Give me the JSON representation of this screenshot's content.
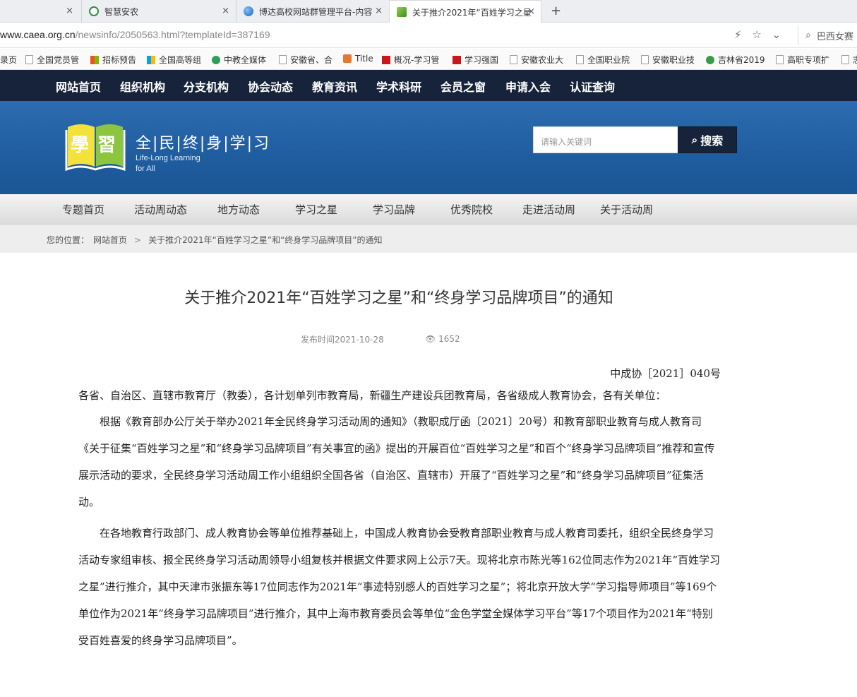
{
  "browser": {
    "tabs": [
      {
        "label": "",
        "close": "×"
      },
      {
        "label": "智慧安农",
        "close": "×"
      },
      {
        "label": "博达高校网站群管理平台-内容",
        "close": "×"
      },
      {
        "label": "关于推介2021年“百姓学习之星",
        "close": "×"
      }
    ],
    "new_tab": "+",
    "url_host": "www.caea.org.cn",
    "url_path": "/newsinfo/2050563.html?templateId=387169",
    "search_text": "巴西女赛",
    "bookmarks": [
      "录页",
      "全国党员管",
      "招标预告",
      "全国高等组",
      "中教全媒体",
      "安徽省、合",
      "Title",
      "概况-学习管",
      "学习强国",
      "安徽农业大",
      "全国职业院",
      "安徽职业技",
      "吉林省2019",
      "高职专项扩",
      "志"
    ]
  },
  "topnav": [
    "网站首页",
    "组织机构",
    "分支机构",
    "协会动态",
    "教育资讯",
    "学术科研",
    "会员之窗",
    "申请入会",
    "认证查询"
  ],
  "banner": {
    "logo_cn": "全|民|终|身|学|习",
    "logo_en_1": "Life-Long Learning",
    "logo_en_2": "for All",
    "search_placeholder": "请输入关键词",
    "search_button": "搜索"
  },
  "subnav": [
    "专题首页",
    "活动周动态",
    "地方动态",
    "学习之星",
    "学习品牌",
    "优秀院校",
    "走进活动周",
    "关于活动周"
  ],
  "breadcrumb": {
    "prefix": "您的位置：",
    "home": "网站首页",
    "sep": ">",
    "current": "关于推介2021年“百姓学习之星”和“终身学习品牌项目”的通知"
  },
  "article": {
    "title": "关于推介2021年“百姓学习之星”和“终身学习品牌项目”的通知",
    "publish_time": "发布时间2021-10-28",
    "views": "1652",
    "doc_no": "中成协［2021］040号",
    "salutation": "各省、自治区、直辖市教育厅（教委），各计划单列市教育局，新疆生产建设兵团教育局，各省级成人教育协会，各有关单位：",
    "para1": "根据《教育部办公厅关于举办2021年全民终身学习活动周的通知》（教职成厅函〔2021〕20号）和教育部职业教育与成人教育司《关于征集“百姓学习之星”和“终身学习品牌项目”有关事宜的函》提出的开展百位“百姓学习之星”和百个“终身学习品牌项目”推荐和宣传展示活动的要求，全民终身学习活动周工作小组组织全国各省（自治区、直辖市）开展了“百姓学习之星”和“终身学习品牌项目”征集活动。",
    "para2": "在各地教育行政部门、成人教育协会等单位推荐基础上，中国成人教育协会受教育部职业教育与成人教育司委托，组织全民终身学习活动专家组审核、报全民终身学习活动周领导小组复核并根据文件要求网上公示7天。现将北京市陈光等162位同志作为2021年“百姓学习之星”进行推介，其中天津市张振东等17位同志作为2021年“事迹特别感人的百姓学习之星”；将北京开放大学“学习指导师项目”等169个单位作为2021年“终身学习品牌项目”进行推介，其中上海市教育委员会等单位“金色学堂全媒体学习平台”等17个项目作为2021年“特别受百姓喜爱的终身学习品牌项目”。"
  }
}
